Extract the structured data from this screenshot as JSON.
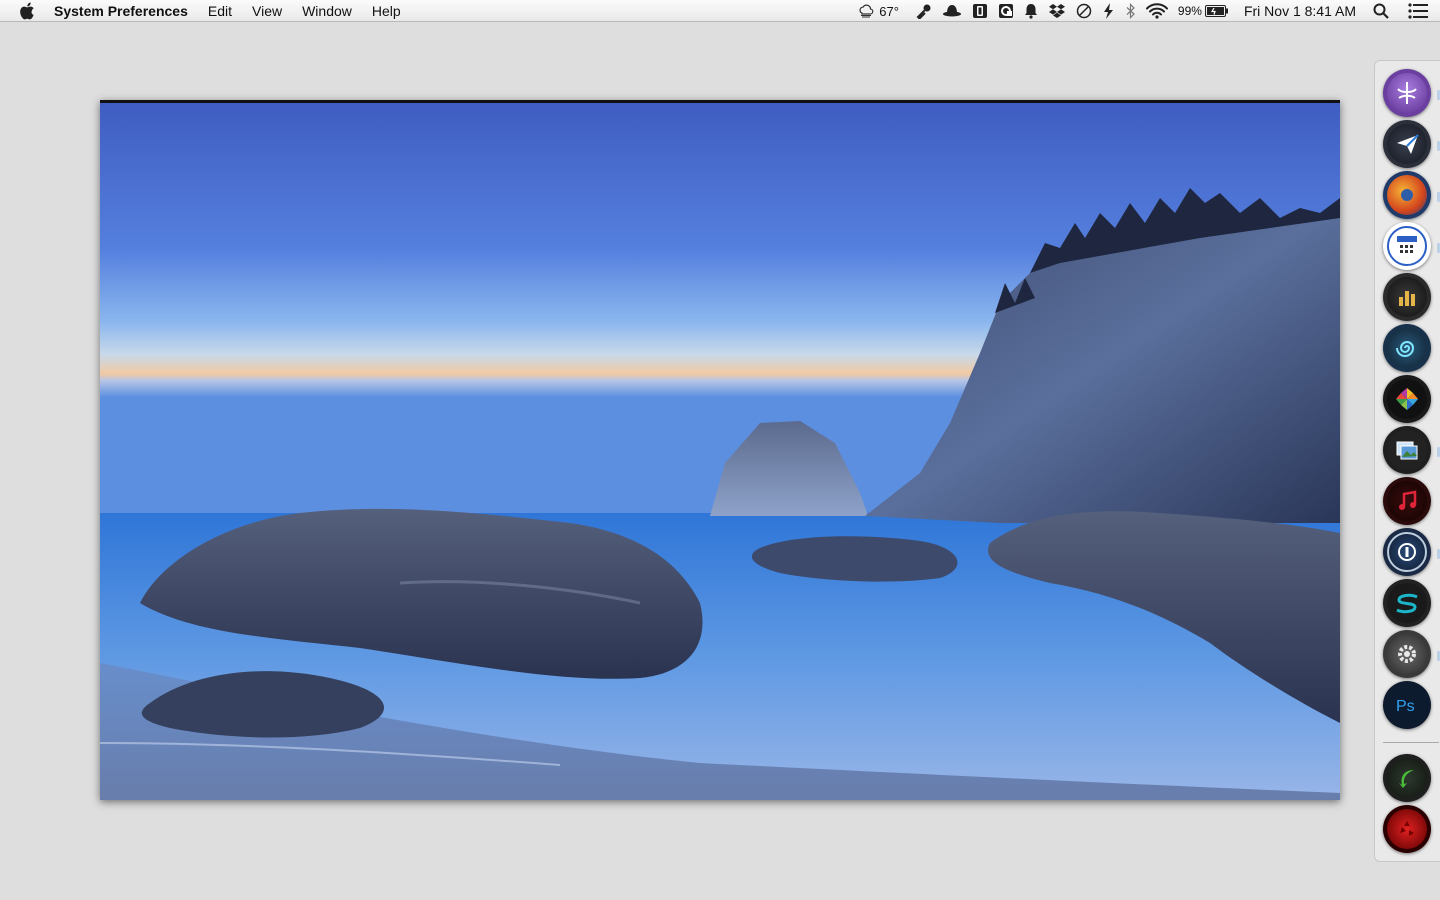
{
  "menubar": {
    "app_name": "System Preferences",
    "menus": [
      "Edit",
      "View",
      "Window",
      "Help"
    ],
    "status": {
      "weather_temp": "67°",
      "battery_percent": "99%",
      "clock": "Fri Nov 1  8:41 AM"
    }
  },
  "dock": {
    "apps": [
      "finder-icon",
      "airmail-icon",
      "firefox-icon",
      "fantastical-icon",
      "stocks-icon",
      "nautilus-icon",
      "photos-icon",
      "preview-icon",
      "itunes-icon",
      "onepassword-icon",
      "sublime-s-icon",
      "system-preferences-icon",
      "photoshop-icon",
      "downloads-icon",
      "trash-icon"
    ]
  },
  "colors": {
    "sky_top": "#3f5dc2",
    "sky_bottom": "#7aa5e8",
    "horizon_glow": "#f4c89a",
    "sea": "#3a7cd6"
  }
}
